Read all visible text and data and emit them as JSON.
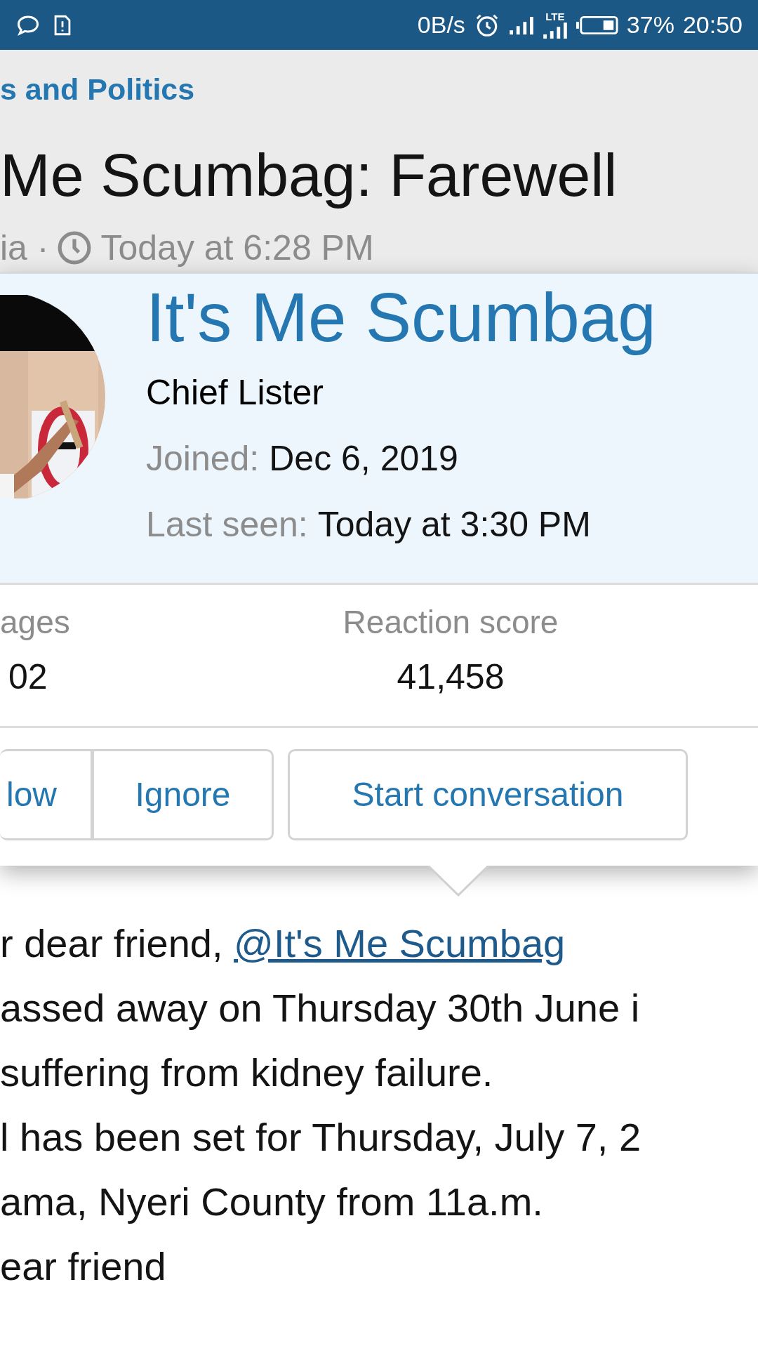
{
  "status_bar": {
    "speed": "0B/s",
    "network": "LTE",
    "battery": "37%",
    "time": "20:50"
  },
  "header": {
    "breadcrumb": "s and Politics",
    "title": "Me Scumbag: Farewell",
    "meta": "ia ·",
    "time": "Today at 6:28 PM"
  },
  "profile_card": {
    "name": "It's Me Scumbag",
    "role": "Chief Lister",
    "facts": [
      {
        "label": "Joined:",
        "value": "Dec 6, 2019"
      },
      {
        "label": "Last seen:",
        "value": "Today at 3:30 PM"
      }
    ],
    "stats": [
      {
        "label": "ages",
        "value": "02"
      },
      {
        "label": "Reaction score",
        "value": "41,458"
      }
    ],
    "buttons": [
      {
        "label": "low",
        "group": true
      },
      {
        "label": "Ignore",
        "group": true
      },
      {
        "label": "Start conversation",
        "group": false
      }
    ]
  },
  "post": {
    "mention_prefix": "r dear friend, ",
    "mention": "@It's Me Scumbag",
    "lines": [
      "assed away on Thursday 30th June i",
      "suffering from kidney failure.",
      "l has been set for Thursday, July 7, 2",
      "ama, Nyeri County from 11a.m.",
      "ear friend"
    ]
  }
}
